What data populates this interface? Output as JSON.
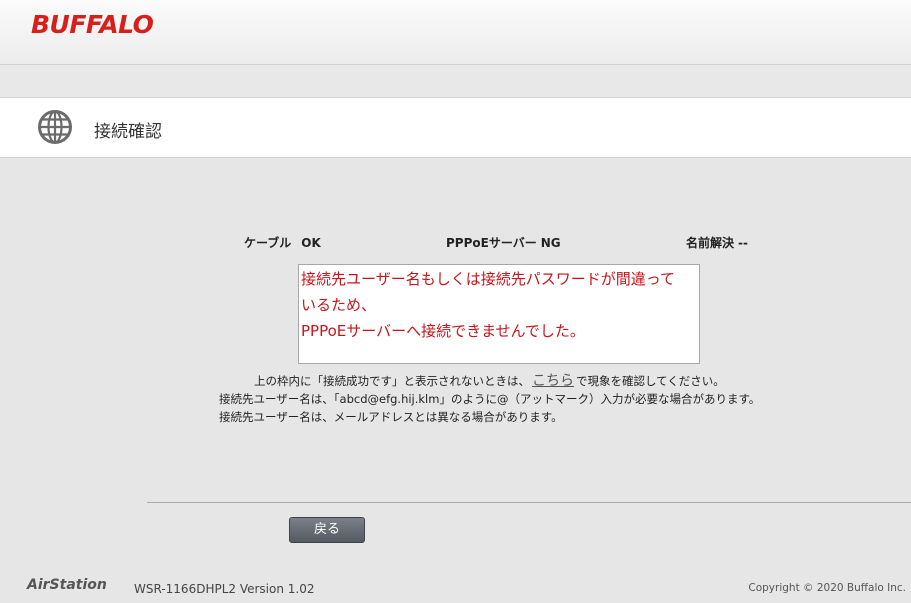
{
  "header": {
    "logo": "BUFFALO"
  },
  "title_bar": {
    "title": "接続確認",
    "icon": "globe-icon"
  },
  "status": {
    "cable_label": "ケーブル",
    "cable_value": "OK",
    "pppoe_label": "PPPoEサーバー",
    "pppoe_value": "NG",
    "dns_label": "名前解決",
    "dns_value": "--"
  },
  "message_box": {
    "lines": [
      "接続先ユーザー名もしくは接続先パスワードが間違って",
      "いるため、",
      "PPPoEサーバーへ接続できませんでした。"
    ],
    "color": "#c8151b"
  },
  "notes": {
    "line1_before": "上の枠内に「接続成功です」と表示されないときは、",
    "line1_link": "こちら",
    "line1_after": "で現象を確認してください。",
    "line2": "接続先ユーザー名は、「abcd@efg.hij.klm」のように@（アットマーク）入力が必要な場合があります。",
    "line3": "接続先ユーザー名は、メールアドレスとは異なる場合があります。"
  },
  "buttons": {
    "back": "戻る"
  },
  "footer": {
    "brand": "AirStation",
    "model": "WSR-1166DHPL2 Version 1.02",
    "copyright": "Copyright © 2020 Buffalo Inc."
  },
  "colors": {
    "brand_red": "#d7201c",
    "error_red": "#c8151b"
  }
}
